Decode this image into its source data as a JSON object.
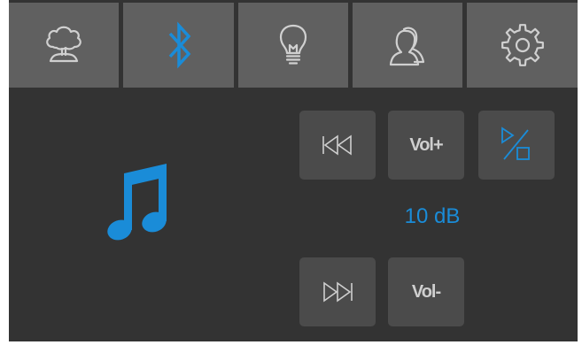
{
  "tabs": [
    {
      "icon": "tree-icon",
      "active": false
    },
    {
      "icon": "bluetooth-icon",
      "active": true
    },
    {
      "icon": "lightbulb-icon",
      "active": false
    },
    {
      "icon": "users-icon",
      "active": false
    },
    {
      "icon": "gear-icon",
      "active": false
    }
  ],
  "player": {
    "icon": "music-note-icon",
    "volume_readout": "10 dB",
    "controls": {
      "previous_icon": "skip-back-icon",
      "volume_up_label": "Vol+",
      "shuffle_icon": "shapes-toggle-icon",
      "next_icon": "skip-forward-icon",
      "volume_down_label": "Vol-"
    }
  },
  "colors": {
    "background": "#333333",
    "tab_background": "#606060",
    "button_background": "#4b4b4b",
    "icon_gray": "#d0d0d0",
    "accent": "#1a8cd8",
    "button_text": "#cfcfcf"
  }
}
